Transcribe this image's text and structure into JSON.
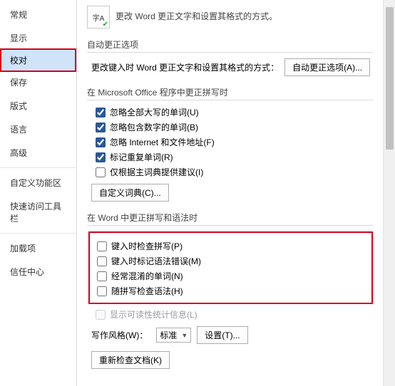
{
  "sidebar": {
    "items": [
      {
        "label": "常规"
      },
      {
        "label": "显示"
      },
      {
        "label": "校对"
      },
      {
        "label": "保存"
      },
      {
        "label": "版式"
      },
      {
        "label": "语言"
      },
      {
        "label": "高级"
      },
      {
        "label": "自定义功能区"
      },
      {
        "label": "快速访问工具栏"
      },
      {
        "label": "加载项"
      },
      {
        "label": "信任中心"
      }
    ]
  },
  "header": {
    "icon_text": "字A",
    "desc": "更改 Word 更正文字和设置其格式的方式。"
  },
  "sections": {
    "autocorrect_title": "自动更正选项",
    "autocorrect_desc": "更改键入时 Word 更正文字和设置其格式的方式：",
    "autocorrect_btn": "自动更正选项(A)...",
    "office_title": "在 Microsoft Office 程序中更正拼写时",
    "office_checks": [
      {
        "label": "忽略全部大写的单词(U)",
        "checked": true
      },
      {
        "label": "忽略包含数字的单词(B)",
        "checked": true
      },
      {
        "label": "忽略 Internet 和文件地址(F)",
        "checked": true
      },
      {
        "label": "标记重复单词(R)",
        "checked": true
      },
      {
        "label": "仅根据主词典提供建议(I)",
        "checked": false
      }
    ],
    "custom_dict_btn": "自定义词典(C)...",
    "word_title": "在 Word 中更正拼写和语法时",
    "word_checks": [
      {
        "label": "键入时检查拼写(P)",
        "checked": false
      },
      {
        "label": "键入时标记语法错误(M)",
        "checked": false
      },
      {
        "label": "经常混淆的单词(N)",
        "checked": false
      },
      {
        "label": "随拼写检查语法(H)",
        "checked": false
      }
    ],
    "readability": {
      "label": "显示可读性统计信息(L)",
      "checked": false
    },
    "writing_style_label": "写作风格(W)：",
    "writing_style_value": "标准",
    "settings_btn": "设置(T)...",
    "recheck_btn": "重新检查文档(K)"
  }
}
